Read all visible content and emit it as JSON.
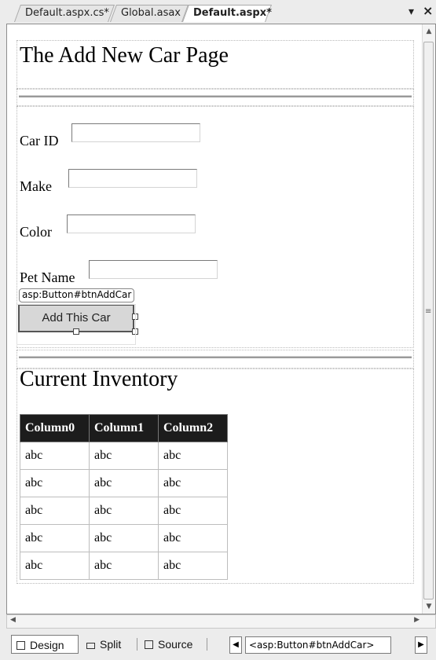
{
  "tabs": [
    {
      "label": "Default.aspx.cs*",
      "active": false
    },
    {
      "label": "Global.asax",
      "active": false
    },
    {
      "label": "Default.aspx*",
      "active": true
    }
  ],
  "tabbar": {
    "dropdown_glyph": "▾",
    "close_glyph": "×"
  },
  "page": {
    "title": "The Add New Car Page",
    "fields": [
      {
        "label": "Car ID",
        "value": ""
      },
      {
        "label": "Make",
        "value": ""
      },
      {
        "label": "Color",
        "value": ""
      },
      {
        "label": "Pet Name",
        "value": ""
      }
    ],
    "button_tag": "asp:Button#btnAddCar",
    "button_label": "Add This Car",
    "inventory_title": "Current Inventory",
    "grid": {
      "headers": [
        "Column0",
        "Column1",
        "Column2"
      ],
      "rows": [
        [
          "abc",
          "abc",
          "abc"
        ],
        [
          "abc",
          "abc",
          "abc"
        ],
        [
          "abc",
          "abc",
          "abc"
        ],
        [
          "abc",
          "abc",
          "abc"
        ],
        [
          "abc",
          "abc",
          "abc"
        ]
      ]
    }
  },
  "bottom": {
    "design": "Design",
    "split": "Split",
    "source": "Source",
    "breadcrumb": "<asp:Button#btnAddCar>"
  }
}
